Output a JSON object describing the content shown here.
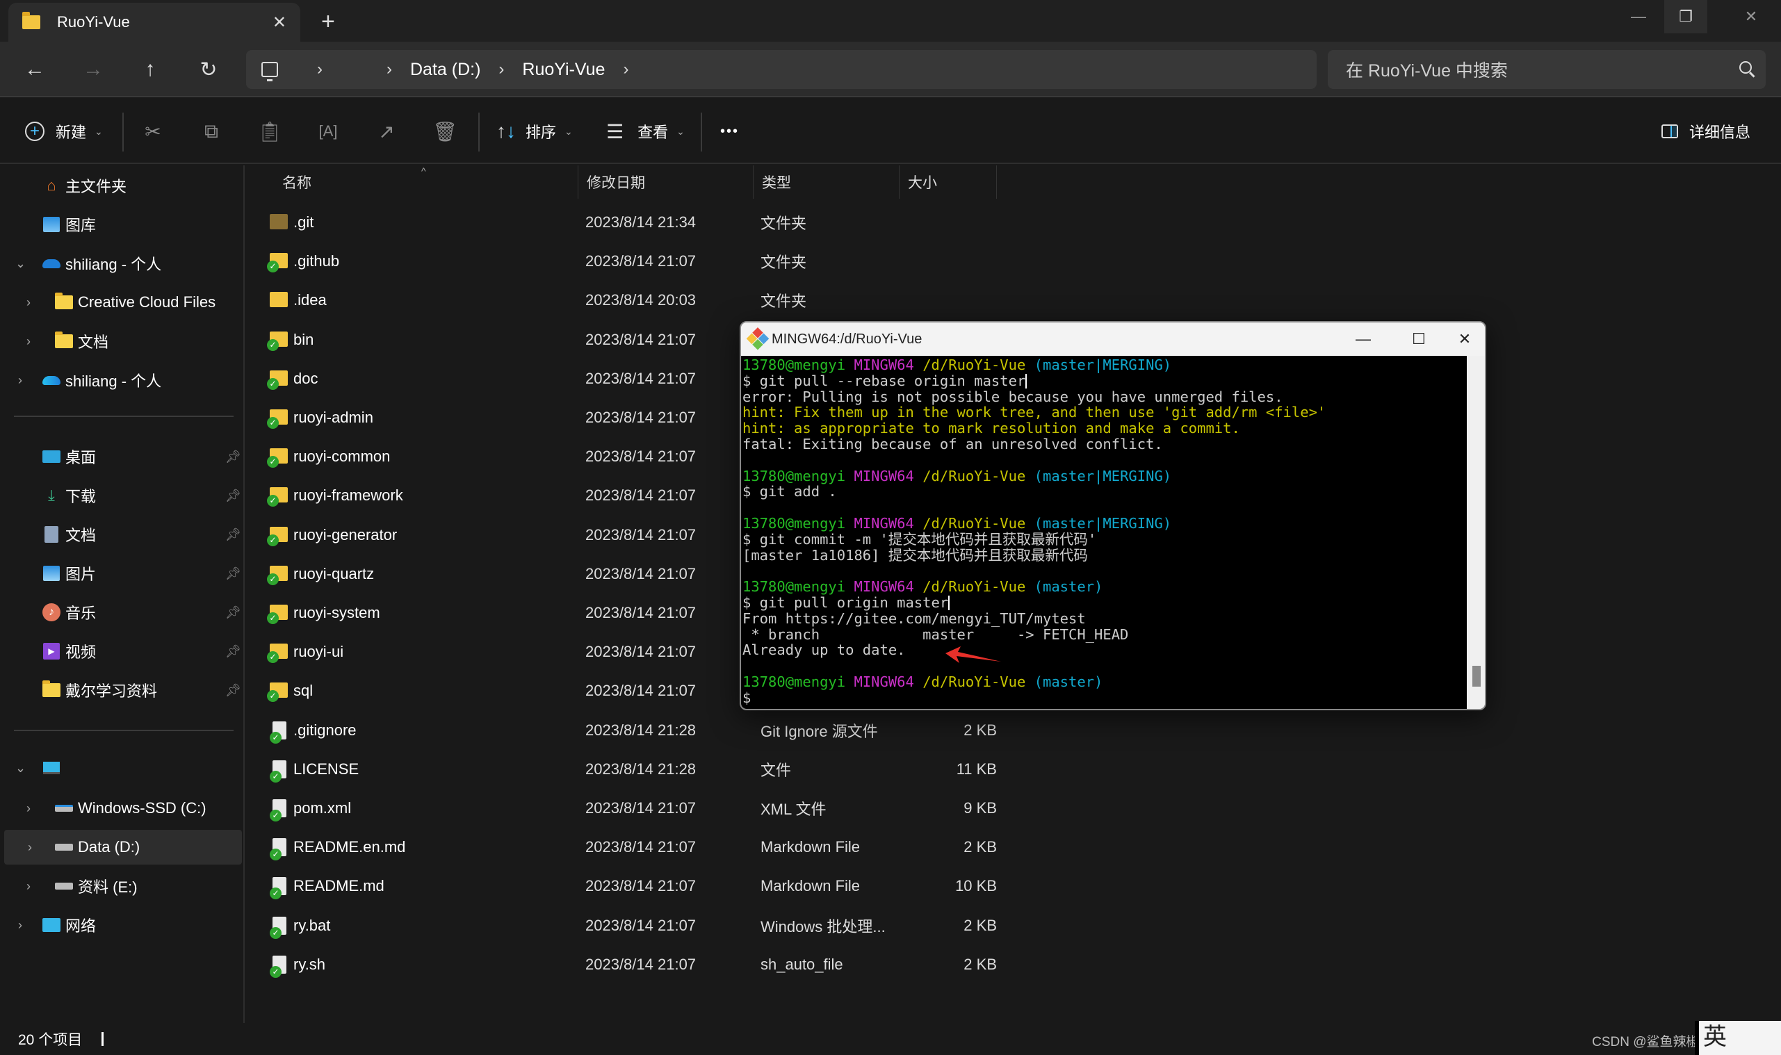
{
  "window": {
    "tab_title": "RuoYi-Vue",
    "tab_close": "✕",
    "new_tab": "+",
    "controls": {
      "minimize": "—",
      "restore": "❐",
      "close": "✕"
    }
  },
  "nav": {
    "back": "←",
    "forward": "→",
    "up": "↑",
    "refresh": "↻"
  },
  "address": {
    "segments": [
      "",
      "Data (D:)",
      "RuoYi-Vue"
    ],
    "separator": "›"
  },
  "search": {
    "placeholder": "在 RuoYi-Vue 中搜索"
  },
  "toolbar": {
    "new_label": "新建",
    "sort_label": "排序",
    "view_label": "查看",
    "more": "•••",
    "details_label": "详细信息",
    "chevron": "⌄"
  },
  "sidebar": {
    "items": [
      {
        "label": "主文件夹",
        "icon": "home-icon"
      },
      {
        "label": "图库",
        "icon": "gallery-icon"
      },
      {
        "label": "shiliang - 个人",
        "icon": "onedrive-icon",
        "expanded": true
      },
      {
        "label": "Creative Cloud Files",
        "icon": "folder-icon"
      },
      {
        "label": "文档",
        "icon": "folder-icon"
      },
      {
        "label": "shiliang - 个人",
        "icon": "onedrive-icon",
        "expanded": false
      }
    ],
    "quick_access": [
      {
        "label": "桌面",
        "icon": "desktop-icon",
        "pinned": true
      },
      {
        "label": "下载",
        "icon": "download-icon",
        "pinned": true
      },
      {
        "label": "文档",
        "icon": "documents-icon",
        "pinned": true
      },
      {
        "label": "图片",
        "icon": "pictures-icon",
        "pinned": true
      },
      {
        "label": "音乐",
        "icon": "music-icon",
        "pinned": true
      },
      {
        "label": "视频",
        "icon": "videos-icon",
        "pinned": true
      },
      {
        "label": "戴尔学习资料",
        "icon": "folder-icon",
        "pinned": true
      }
    ],
    "this_pc": {
      "label": "",
      "icon": "monitor-icon",
      "expanded": true
    },
    "drives": [
      {
        "label": "Windows-SSD (C:)",
        "icon": "drive-icon"
      },
      {
        "label": "Data (D:)",
        "icon": "drive-icon",
        "selected": true
      },
      {
        "label": "资料 (E:)",
        "icon": "drive-icon"
      }
    ],
    "network": {
      "label": "网络",
      "icon": "network-icon"
    }
  },
  "columns": {
    "name": "名称",
    "date": "修改日期",
    "type": "类型",
    "size": "大小"
  },
  "files": [
    {
      "name": ".git",
      "date": "2023/8/14 21:34",
      "type": "文件夹",
      "size": "",
      "kind": "folder-dark"
    },
    {
      "name": ".github",
      "date": "2023/8/14 21:07",
      "type": "文件夹",
      "size": "",
      "kind": "folder-check"
    },
    {
      "name": ".idea",
      "date": "2023/8/14 20:03",
      "type": "文件夹",
      "size": "",
      "kind": "folder"
    },
    {
      "name": "bin",
      "date": "2023/8/14 21:07",
      "type": "",
      "size": "",
      "kind": "folder-check"
    },
    {
      "name": "doc",
      "date": "2023/8/14 21:07",
      "type": "",
      "size": "",
      "kind": "folder-check"
    },
    {
      "name": "ruoyi-admin",
      "date": "2023/8/14 21:07",
      "type": "",
      "size": "",
      "kind": "folder-check"
    },
    {
      "name": "ruoyi-common",
      "date": "2023/8/14 21:07",
      "type": "",
      "size": "",
      "kind": "folder-check"
    },
    {
      "name": "ruoyi-framework",
      "date": "2023/8/14 21:07",
      "type": "",
      "size": "",
      "kind": "folder-check"
    },
    {
      "name": "ruoyi-generator",
      "date": "2023/8/14 21:07",
      "type": "",
      "size": "",
      "kind": "folder-check"
    },
    {
      "name": "ruoyi-quartz",
      "date": "2023/8/14 21:07",
      "type": "",
      "size": "",
      "kind": "folder-check"
    },
    {
      "name": "ruoyi-system",
      "date": "2023/8/14 21:07",
      "type": "",
      "size": "",
      "kind": "folder-check"
    },
    {
      "name": "ruoyi-ui",
      "date": "2023/8/14 21:07",
      "type": "",
      "size": "",
      "kind": "folder-check"
    },
    {
      "name": "sql",
      "date": "2023/8/14 21:07",
      "type": "",
      "size": "",
      "kind": "folder-check"
    },
    {
      "name": ".gitignore",
      "date": "2023/8/14 21:28",
      "type": "Git Ignore 源文件",
      "size": "2 KB",
      "kind": "file-check"
    },
    {
      "name": "LICENSE",
      "date": "2023/8/14 21:28",
      "type": "文件",
      "size": "11 KB",
      "kind": "file-check"
    },
    {
      "name": "pom.xml",
      "date": "2023/8/14 21:07",
      "type": "XML 文件",
      "size": "9 KB",
      "kind": "file-check"
    },
    {
      "name": "README.en.md",
      "date": "2023/8/14 21:07",
      "type": "Markdown File",
      "size": "2 KB",
      "kind": "file-check"
    },
    {
      "name": "README.md",
      "date": "2023/8/14 21:07",
      "type": "Markdown File",
      "size": "10 KB",
      "kind": "file-check"
    },
    {
      "name": "ry.bat",
      "date": "2023/8/14 21:07",
      "type": "Windows 批处理...",
      "size": "2 KB",
      "kind": "file-check"
    },
    {
      "name": "ry.sh",
      "date": "2023/8/14 21:07",
      "type": "sh_auto_file",
      "size": "2 KB",
      "kind": "file-check"
    }
  ],
  "status": {
    "item_count": "20 个项目"
  },
  "watermark": "CSDN @鲨鱼辣椒_TUT",
  "ime_indicator": "英",
  "terminal": {
    "title": "MINGW64:/d/RuoYi-Vue",
    "controls": {
      "minimize": "—",
      "maximize": "☐",
      "close": "✕"
    },
    "prompt": {
      "user": "13780@mengyi",
      "system": "MINGW64",
      "path": "/d/RuoYi-Vue"
    },
    "blocks": [
      {
        "branch": "(master|MERGING)",
        "command": "$ git pull --rebase origin master",
        "cursor": true,
        "output": [
          {
            "text": "error: Pulling is not possible because you have unmerged files.",
            "style": "white"
          },
          {
            "text": "hint: Fix them up in the work tree, and then use 'git add/rm <file>'",
            "style": "hint"
          },
          {
            "text": "hint: as appropriate to mark resolution and make a commit.",
            "style": "hint"
          },
          {
            "text": "fatal: Exiting because of an unresolved conflict.",
            "style": "white"
          }
        ]
      },
      {
        "branch": "(master|MERGING)",
        "command": "$ git add .",
        "cursor": false,
        "output": []
      },
      {
        "branch": "(master|MERGING)",
        "command": "$ git commit -m '提交本地代码并且获取最新代码'",
        "cursor": false,
        "output": [
          {
            "text": "[master 1a10186] 提交本地代码并且获取最新代码",
            "style": "white"
          }
        ]
      },
      {
        "branch": "(master)",
        "command": "$ git pull origin master",
        "cursor": true,
        "output": [
          {
            "text": "From https://gitee.com/mengyi_TUT/mytest",
            "style": "white"
          },
          {
            "text": " * branch            master     -> FETCH_HEAD",
            "style": "white"
          },
          {
            "text": "Already up to date.",
            "style": "white"
          }
        ]
      },
      {
        "branch": "(master)",
        "command": "$",
        "cursor": false,
        "output": []
      }
    ],
    "annotation_color": "#e8302a"
  }
}
